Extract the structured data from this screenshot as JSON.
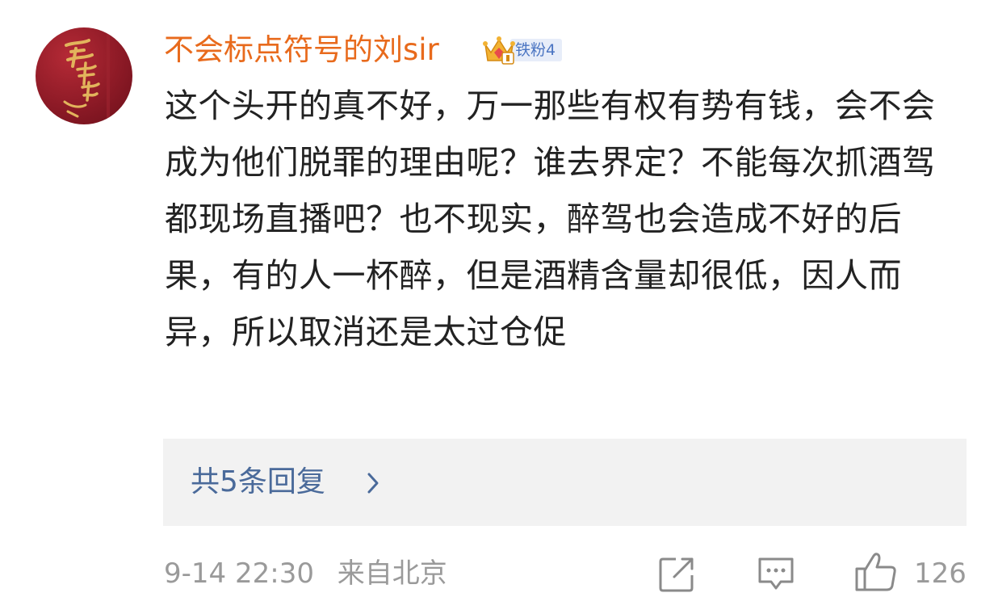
{
  "comment": {
    "username": "不会标点符号的刘sir",
    "badge": {
      "icon": "crown-icon",
      "label": "铁粉4"
    },
    "body": "这个头开的真不好，万一那些有权有势有钱，会不会成为他们脱罪的理由呢？谁去界定？不能每次抓酒驾都现场直播吧？也不现实，醉驾也会造成不好的后果，有的人一杯醉，但是酒精含量却很低，因人而异，所以取消还是太过仓促",
    "avatar": {
      "text": "诸事顺利",
      "bg_color": "#8d1a26",
      "text_color": "#e2b45c"
    }
  },
  "replies": {
    "label": "共5条回复",
    "icon": "chevron-right-icon"
  },
  "footer": {
    "timestamp": "9-14 22:30",
    "location": "来自北京",
    "like_count": "126"
  },
  "colors": {
    "username": "#e86a1c",
    "link": "#4a6a9a",
    "meta": "#9a9a9a",
    "text": "#222222"
  }
}
